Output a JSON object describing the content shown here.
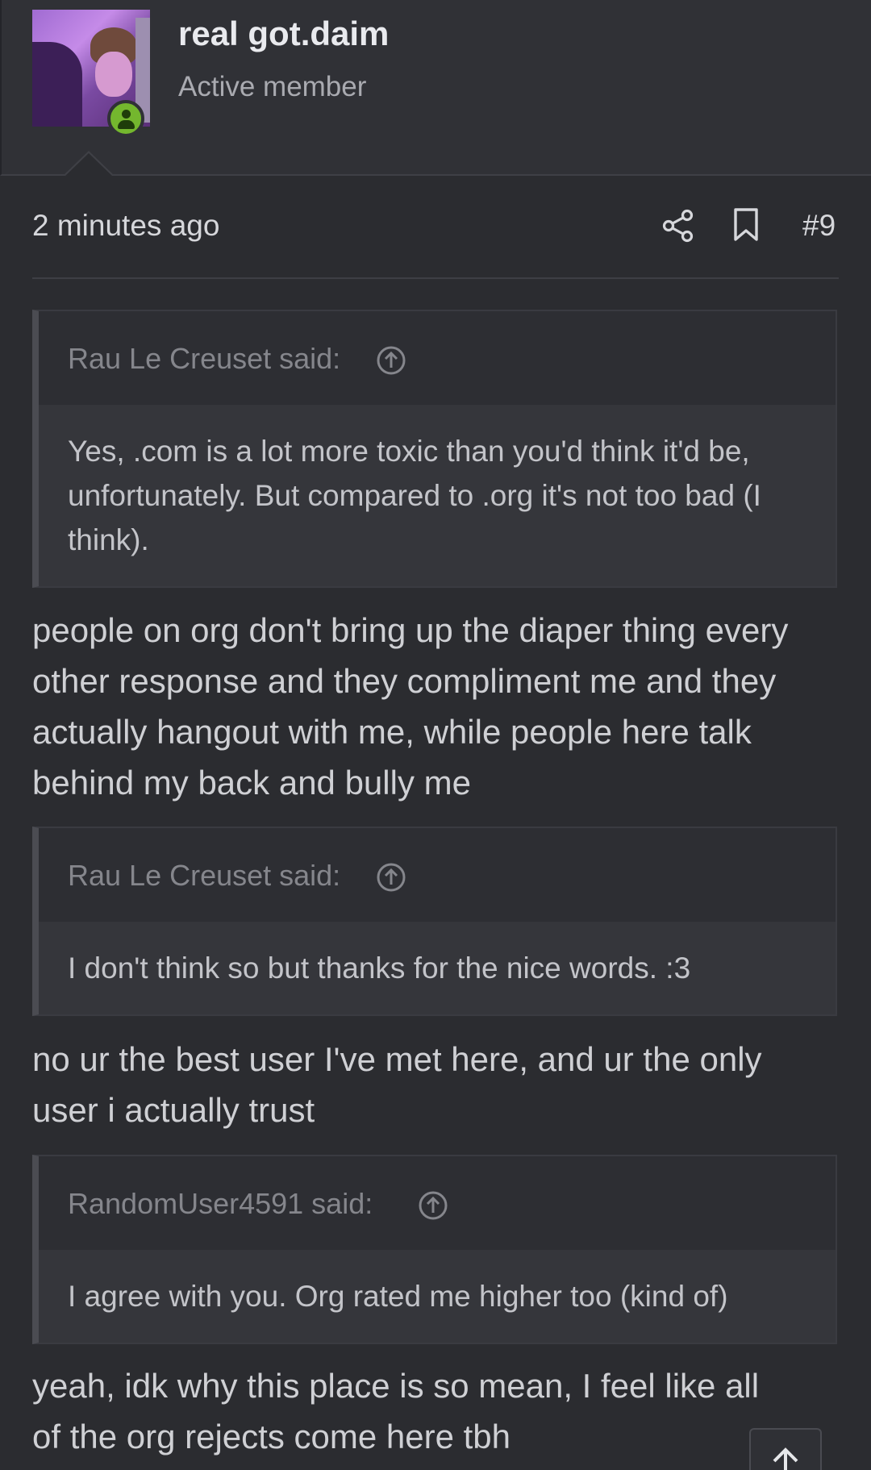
{
  "user": {
    "name": "real got.daim",
    "title": "Active member",
    "online_status_icon": "user-online-icon"
  },
  "post": {
    "time": "2 minutes ago",
    "number": "#9",
    "icons": [
      "share-icon",
      "bookmark-icon"
    ]
  },
  "blocks": [
    {
      "type": "quote",
      "author": "Rau Le Creuset said:",
      "lines": [
        "Yes, .com is a lot more toxic than you'd think it'd be,",
        "unfortunately. But compared to .org it's not too bad (I",
        "think)."
      ]
    },
    {
      "type": "reply",
      "lines": [
        "people on org don't bring up the diaper thing every",
        "other response and they compliment me and they",
        "actually hangout with me, while people here talk",
        "behind my back and bully me"
      ]
    },
    {
      "type": "quote",
      "author": "Rau Le Creuset said:",
      "lines": [
        "I don't think so but thanks for the nice words. :3"
      ]
    },
    {
      "type": "reply",
      "lines": [
        "no ur the best user I've met here, and ur the only",
        "user i actually trust"
      ]
    },
    {
      "type": "quote",
      "author": "RandomUser4591 said:",
      "lines": [
        "I agree with you. Org rated me higher too (kind of)"
      ]
    },
    {
      "type": "reply",
      "lines": [
        "yeah, idk why this place is so mean, I feel like all",
        "of the org rejects come here tbh"
      ]
    }
  ],
  "colors": {
    "background": "#2b2c30",
    "online": "#74b72e",
    "accent_red": "#d22323"
  }
}
